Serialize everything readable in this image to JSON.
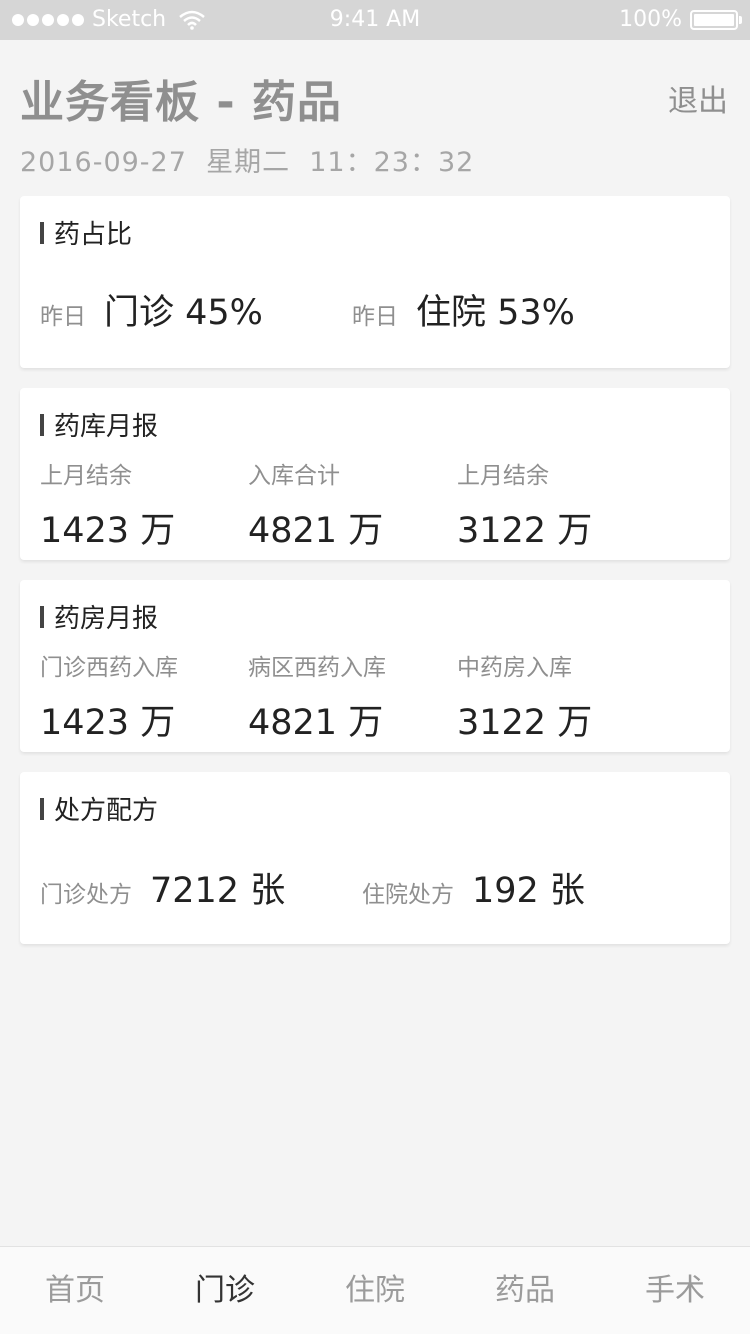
{
  "status_bar": {
    "carrier": "Sketch",
    "time": "9:41 AM",
    "battery": "100%"
  },
  "header": {
    "title": "业务看板 - 药品",
    "logout_label": "退出",
    "datetime": "2016-09-27  星期二  11：23：32"
  },
  "cards": {
    "ratio": {
      "title": "药占比",
      "items": [
        {
          "label": "昨日",
          "value": "门诊 45%"
        },
        {
          "label": "昨日",
          "value": "住院 53%"
        }
      ]
    },
    "warehouse": {
      "title": "药库月报",
      "items": [
        {
          "label": "上月结余",
          "value": "1423 万"
        },
        {
          "label": "入库合计",
          "value": "4821 万"
        },
        {
          "label": "上月结余",
          "value": "3122 万"
        }
      ]
    },
    "pharmacy": {
      "title": "药房月报",
      "items": [
        {
          "label": "门诊西药入库",
          "value": "1423 万"
        },
        {
          "label": "病区西药入库",
          "value": "4821 万"
        },
        {
          "label": "中药房入库",
          "value": "3122 万"
        }
      ]
    },
    "prescription": {
      "title": "处方配方",
      "items": [
        {
          "label": "门诊处方",
          "value": "7212 张"
        },
        {
          "label": "住院处方",
          "value": "192 张"
        }
      ]
    }
  },
  "tabs": [
    {
      "label": "首页"
    },
    {
      "label": "门诊"
    },
    {
      "label": "住院"
    },
    {
      "label": "药品"
    },
    {
      "label": "手术"
    }
  ]
}
